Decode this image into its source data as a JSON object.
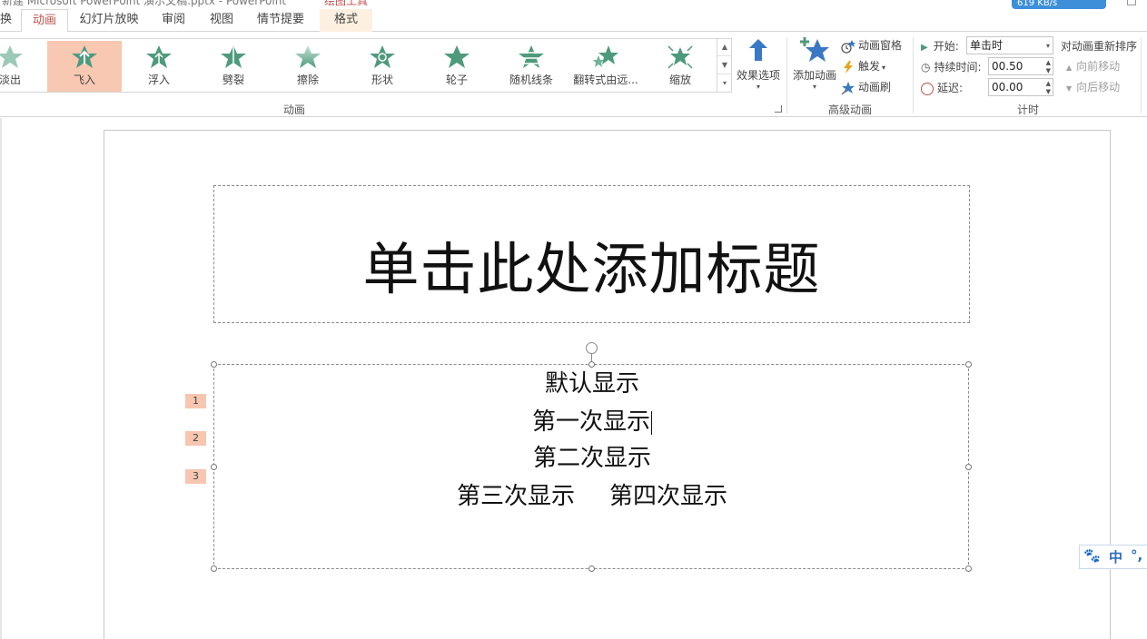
{
  "window": {
    "doc_title": "新建 Microsoft PowerPoint 演示文稿.pptx - PowerPoint",
    "context_group": "绘图工具",
    "speed": "619 KB/s"
  },
  "tabs": [
    {
      "label": "切换",
      "state": "normal"
    },
    {
      "label": "动画",
      "state": "active"
    },
    {
      "label": "幻灯片放映",
      "state": "normal"
    },
    {
      "label": "审阅",
      "state": "normal"
    },
    {
      "label": "视图",
      "state": "normal"
    },
    {
      "label": "情节提要",
      "state": "normal"
    },
    {
      "label": "格式",
      "state": "context"
    }
  ],
  "animations": {
    "group_label": "动画",
    "items": [
      {
        "label": "淡出",
        "icon": "fade-icon"
      },
      {
        "label": "飞入",
        "icon": "fly-in-icon",
        "selected": true
      },
      {
        "label": "浮入",
        "icon": "float-in-icon"
      },
      {
        "label": "劈裂",
        "icon": "split-icon"
      },
      {
        "label": "擦除",
        "icon": "wipe-icon"
      },
      {
        "label": "形状",
        "icon": "shape-icon"
      },
      {
        "label": "轮子",
        "icon": "wheel-icon"
      },
      {
        "label": "随机线条",
        "icon": "random-bars-icon"
      },
      {
        "label": "翻转式由远...",
        "icon": "grow-turn-icon"
      },
      {
        "label": "缩放",
        "icon": "zoom-icon"
      }
    ],
    "effect_options": "效果选项"
  },
  "advanced": {
    "group_label": "高级动画",
    "add_animation": "添加动画",
    "animation_pane": "动画窗格",
    "trigger": "触发",
    "animation_painter": "动画刷"
  },
  "timing": {
    "group_label": "计时",
    "start_label": "开始:",
    "start_value": "单击时",
    "duration_label": "持续时间:",
    "duration_value": "00.50",
    "delay_label": "延迟:",
    "delay_value": "00.00",
    "reorder_label": "对动画重新排序",
    "move_earlier": "向前移动",
    "move_later": "向后移动"
  },
  "slide": {
    "title_placeholder": "单击此处添加标题",
    "body_lines": [
      "默认显示",
      "第一次显示",
      "第二次显示",
      "第三次显示",
      "第四次显示"
    ],
    "animation_tags": [
      "1",
      "2",
      "3"
    ]
  },
  "ime": {
    "mode": "中",
    "punct": "°,"
  },
  "colors": {
    "accent": "#c0504d",
    "selection": "#f8c8b2",
    "star": "#4e9a7c"
  }
}
